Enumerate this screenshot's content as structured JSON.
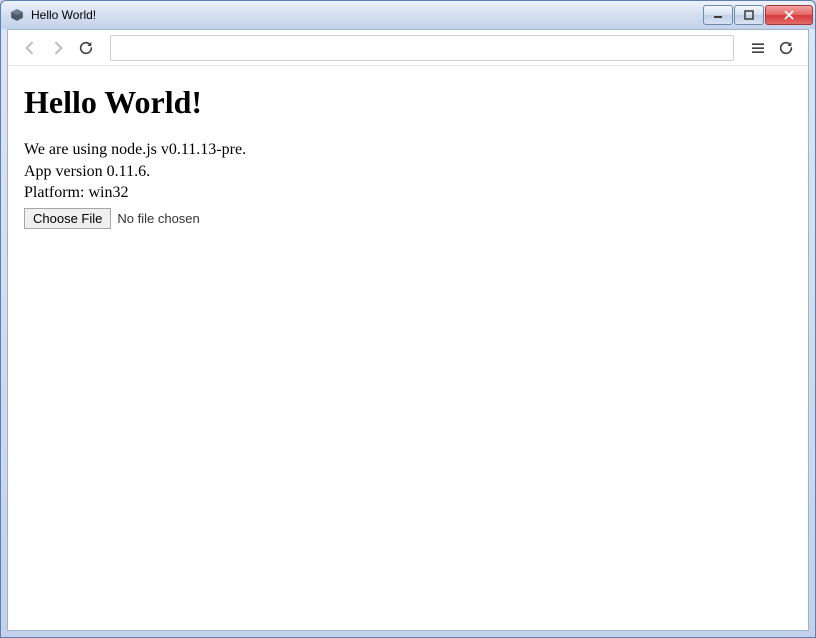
{
  "window": {
    "title": "Hello World!"
  },
  "toolbar": {
    "address_value": ""
  },
  "page": {
    "heading": "Hello World!",
    "line1": "We are using node.js v0.11.13-pre.",
    "line2": "App version 0.11.6.",
    "line3": "Platform: win32",
    "file_button_label": "Choose File",
    "file_status": "No file chosen"
  }
}
